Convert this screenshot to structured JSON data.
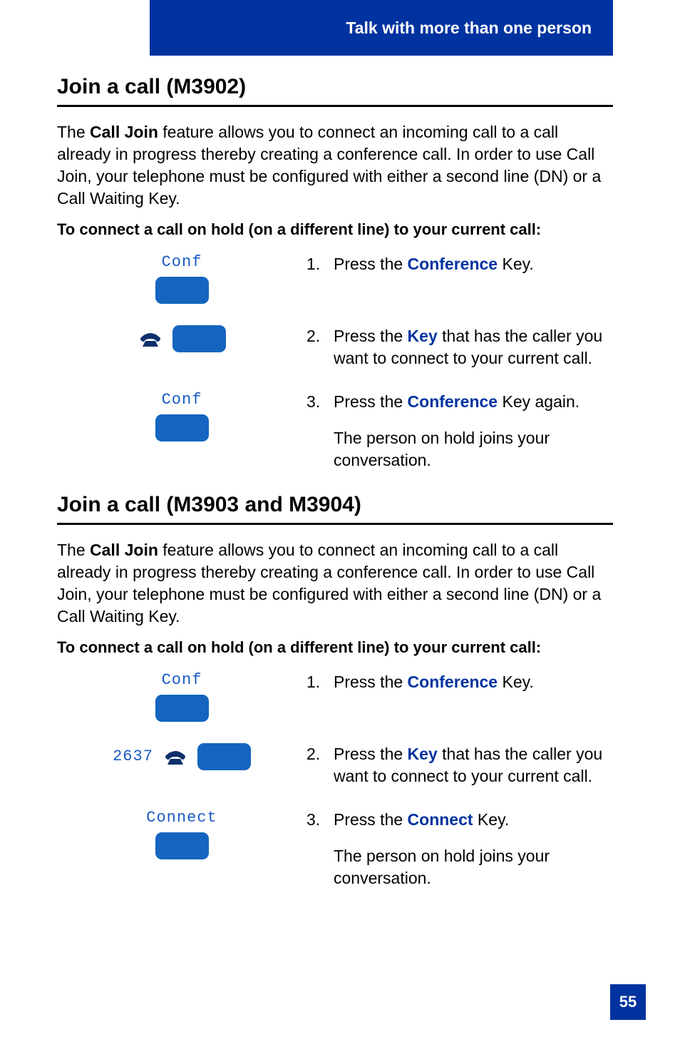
{
  "header": {
    "tab_text": "Talk with more than one person"
  },
  "section1": {
    "title": "Join a call (M3902)",
    "intro_prefix": "The ",
    "intro_bold": "Call Join",
    "intro_suffix": " feature allows you to connect an incoming call to a call already in progress thereby creating a conference call. In order to use Call Join, your telephone must be configured with either a second line (DN) or a Call Waiting Key.",
    "subhead": "To connect a call on hold (on a different line) to your current call:",
    "step1": {
      "key_label": "Conf",
      "num": "1.",
      "text_prefix": "Press the ",
      "keyword": "Conference",
      "text_suffix": " Key."
    },
    "step2": {
      "num": "2.",
      "text_prefix": "Press the ",
      "keyword": "Key",
      "text_suffix": " that has the caller you want to connect to your current call."
    },
    "step3": {
      "key_label": "Conf",
      "num": "3.",
      "text_prefix": "Press the ",
      "keyword": "Conference",
      "text_suffix": " Key again.",
      "result": "The person on hold joins your conversation."
    }
  },
  "section2": {
    "title": "Join a call (M3903 and M3904)",
    "intro_prefix": "The ",
    "intro_bold": "Call Join",
    "intro_suffix": " feature allows you to connect an incoming call to a call already in progress thereby creating a conference call. In order to use Call Join, your telephone must be configured with either a second line (DN) or a Call Waiting Key.",
    "subhead": "To connect a call on hold (on a different line) to your current call:",
    "step1": {
      "key_label": "Conf",
      "num": "1.",
      "text_prefix": "Press the ",
      "keyword": "Conference",
      "text_suffix": " Key."
    },
    "step2": {
      "line_number": "2637",
      "num": "2.",
      "text_prefix": "Press the ",
      "keyword": "Key",
      "text_suffix": " that has the caller you want to connect to your current call."
    },
    "step3": {
      "key_label": "Connect",
      "num": "3.",
      "text_prefix": "Press the ",
      "keyword": "Connect",
      "text_suffix": " Key.",
      "result": "The person on hold joins your conversation."
    }
  },
  "page_number": "55"
}
